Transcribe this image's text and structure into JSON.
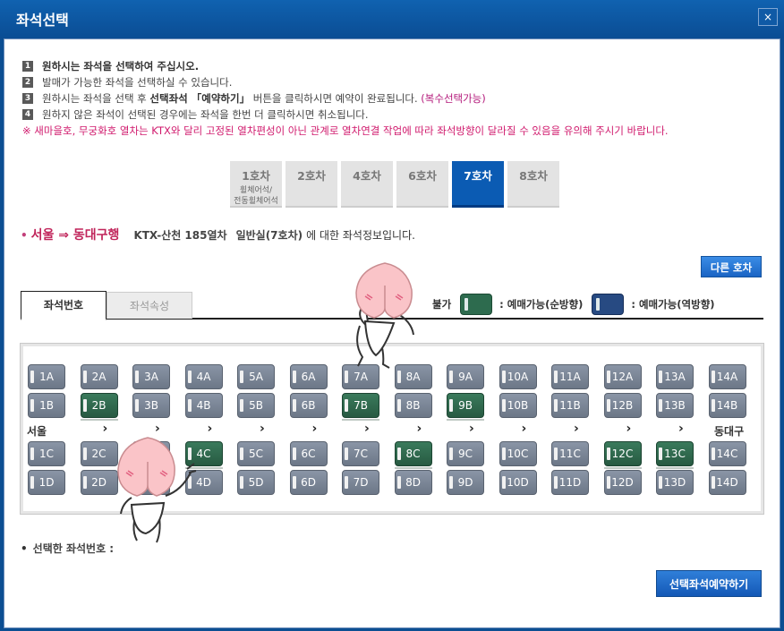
{
  "window": {
    "title": "좌석선택",
    "close": "×"
  },
  "instructions": {
    "n1": "1",
    "line1": "원하시는 좌석을 선택하여 주십시오.",
    "n2": "2",
    "line2": "발매가 가능한 좌석을 선택하실 수 있습니다.",
    "n3": "3",
    "line3_a": "원하시는 좌석을 선택 후",
    "line3_b": "선택좌석 「예약하기」",
    "line3_c": "버튼을 클릭하시면 예약이 완료됩니다.",
    "line3_d": "(복수선택가능)",
    "n4": "4",
    "line4": "원하지 않은 좌석이 선택된 경우에는 좌석을 한번 더 클릭하시면 취소됩니다.",
    "warning": "※ 새마을호, 무궁화호 열차는 KTX와 달리 고정된 열차편성이 아닌 관계로 열차연결 작업에 따라 좌석방향이 달라질 수 있음을 유의해 주시기 바랍니다."
  },
  "cars": [
    {
      "label": "1호차",
      "sub1": "휠체어석/",
      "sub2": "전동휠체어석"
    },
    {
      "label": "2호차"
    },
    {
      "label": "4호차"
    },
    {
      "label": "6호차"
    },
    {
      "label": "7호차",
      "active": true
    },
    {
      "label": "8호차"
    }
  ],
  "route": {
    "dot": "•",
    "name": "서울 ⇒ 동대구행",
    "train": "KTX-산천 185열차",
    "class": "일반실(7호차)",
    "suffix": "에 대한 좌석정보입니다."
  },
  "other_car_button": "다른 호차",
  "tabs": {
    "seat_number": "좌석번호",
    "seat_attr": "좌석속성"
  },
  "legend": {
    "unavailable": "불가",
    "forward": ": 예매가능(순방향)",
    "reverse": ": 예매가능(역방향)"
  },
  "stations": {
    "from": "서울",
    "to": "동대구",
    "arrow": "›"
  },
  "seats": {
    "A": [
      "1A",
      "2A",
      "3A",
      "4A",
      "5A",
      "6A",
      "7A",
      "8A",
      "9A",
      "10A",
      "11A",
      "12A",
      "13A",
      "14A"
    ],
    "B": [
      "1B",
      "2B",
      "3B",
      "4B",
      "5B",
      "6B",
      "7B",
      "8B",
      "9B",
      "10B",
      "11B",
      "12B",
      "13B",
      "14B"
    ],
    "C": [
      "1C",
      "2C",
      "3C",
      "4C",
      "5C",
      "6C",
      "7C",
      "8C",
      "9C",
      "10C",
      "11C",
      "12C",
      "13C",
      "14C"
    ],
    "D": [
      "1D",
      "2D",
      "3D",
      "4D",
      "5D",
      "6D",
      "7D",
      "8D",
      "9D",
      "10D",
      "11D",
      "12D",
      "13D",
      "14D"
    ],
    "available": [
      "2B",
      "7B",
      "9B",
      "4C",
      "8C",
      "12C",
      "13C"
    ]
  },
  "selected_label": "선택한 좌석번호 :",
  "reserve_button": "선택좌석예약하기",
  "colors": {
    "available_forward": "#2d6b4e",
    "available_reverse": "#274a82",
    "unavailable": "#7a8595",
    "active_car": "#0b5bb3",
    "accent_pink": "#c0245a"
  }
}
